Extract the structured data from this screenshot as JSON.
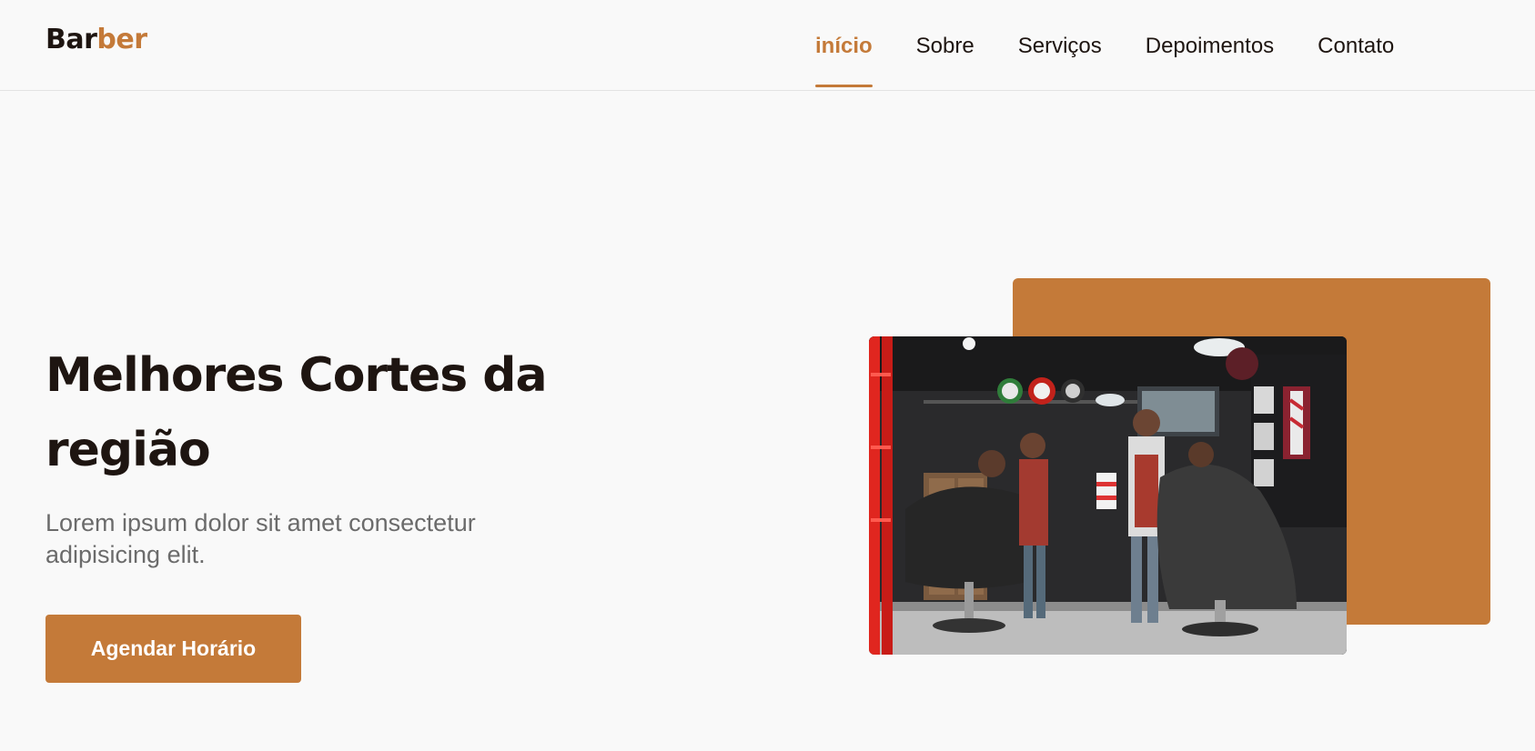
{
  "brand": {
    "logo_part1": "Bar",
    "logo_part2": "ber",
    "accent_color": "#c47a39",
    "text_color": "#1e1511"
  },
  "nav": {
    "items": [
      {
        "label": "início",
        "active": true
      },
      {
        "label": "Sobre",
        "active": false
      },
      {
        "label": "Serviços",
        "active": false
      },
      {
        "label": "Depoimentos",
        "active": false
      },
      {
        "label": "Contato",
        "active": false
      }
    ]
  },
  "hero": {
    "title_line1": "Melhores Cortes da",
    "title_line2": "região",
    "text_line1": "Lorem ipsum dolor sit amet consectetur",
    "text_line2": "adipisicing elit.",
    "cta_label": "Agendar Horário",
    "image": {
      "subject": "barbershop-interior-photo"
    }
  }
}
